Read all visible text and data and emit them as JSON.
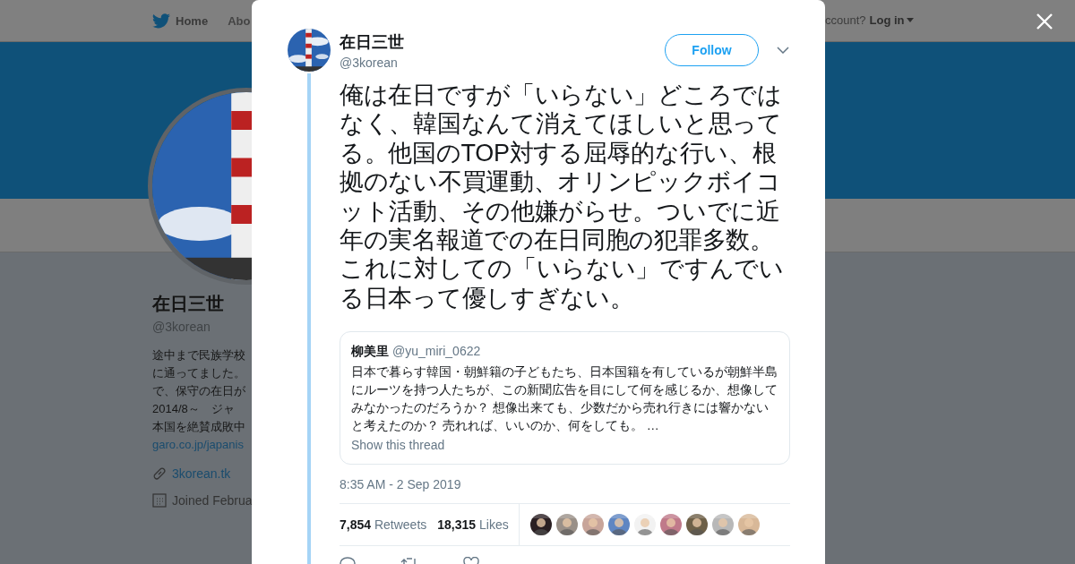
{
  "nav": {
    "items": [
      {
        "label": "Home",
        "selected": true
      },
      {
        "label": "Abo",
        "selected": false
      }
    ],
    "account_prompt": "ccount?",
    "login": "Log in"
  },
  "profile": {
    "name": "在日三世",
    "handle": "@3korean",
    "bio": [
      "途中まで民族学校",
      "に通ってました。",
      "で、保守の在日が",
      "2014/8～　ジャ",
      "本国を絶賛成敗中"
    ],
    "bio_link": "garo.co.jp/japanis",
    "website": "3korean.tk",
    "joined": "Joined Februa"
  },
  "tweet": {
    "author": "在日三世",
    "handle": "@3korean",
    "follow": "Follow",
    "text": "俺は在日ですが「いらない」どころではなく、韓国なんて消えてほしいと思ってる。他国のTOP対する屈辱的な行い、根拠のない不買運動、オリンピックボイコット活動、その他嫌がらせ。ついでに近年の実名報道での在日同胞の犯罪多数。これに対しての「いらない」ですんでいる日本って優しすぎない。",
    "quote": {
      "author": "柳美里",
      "handle": "@yu_miri_0622",
      "text": "日本で暮らす韓国・朝鮮籍の子どもたち、日本国籍を有しているが朝鮮半島にルーツを持つ人たちが、この新聞広告を目にして何を感じるか、想像してみなかったのだろうか？ 想像出来ても、少数だから売れ行きには響かないと考えたのか？ 売れれば、いいのか、何をしても。 …",
      "show_thread": "Show this thread"
    },
    "timestamp": "8:35 AM - 2 Sep 2019",
    "stats": [
      {
        "count": "7,854",
        "label": "Retweets"
      },
      {
        "count": "18,315",
        "label": "Likes"
      }
    ],
    "likers": [
      {
        "color": "#2a1f22"
      },
      {
        "color": "#9a9088"
      },
      {
        "color": "#c8a59a"
      },
      {
        "color": "#5f86c2"
      },
      {
        "color": "#f2f2f2"
      },
      {
        "color": "#c07a8a"
      },
      {
        "color": "#6e6048"
      },
      {
        "color": "#b8b8b8"
      },
      {
        "color": "#d8b898"
      }
    ]
  }
}
